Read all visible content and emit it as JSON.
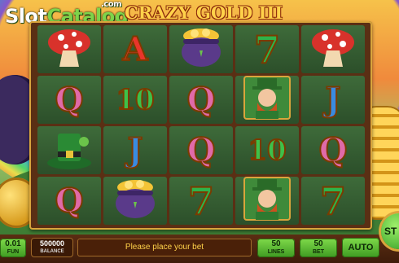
{
  "branding": {
    "logo_prefix": "Slot",
    "logo_highlight": "Catalog",
    "logo_suffix": ".com"
  },
  "game": {
    "title": "CRAZY GOLD III"
  },
  "reels": [
    [
      "mushroom",
      "Q",
      "green-hat",
      "Q"
    ],
    [
      "A",
      "10",
      "J",
      "pot-of-gold"
    ],
    [
      "pot-of-gold",
      "Q",
      "Q",
      "7"
    ],
    [
      "7",
      "leprechaun",
      "10",
      "leprechaun"
    ],
    [
      "mushroom",
      "J",
      "Q",
      "7"
    ]
  ],
  "controls": {
    "coin": {
      "value": "0.01",
      "label": "FUN"
    },
    "balance": {
      "value": "500000",
      "label": "BALANCE"
    },
    "message": "Please place your bet",
    "lines": {
      "value": "50",
      "label": "LINES"
    },
    "bet": {
      "value": "50",
      "label": "BET"
    },
    "auto_label": "AUTO",
    "spin_label": "ST"
  }
}
